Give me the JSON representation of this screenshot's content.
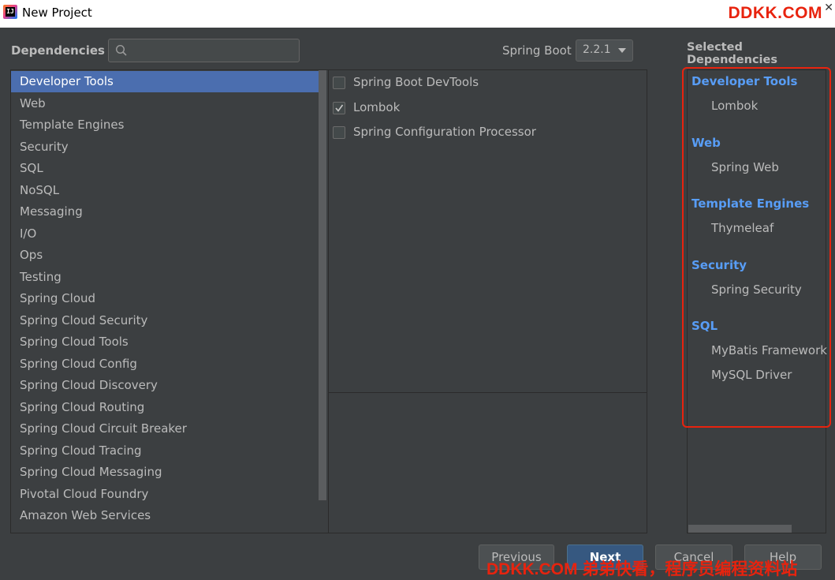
{
  "window": {
    "title": "New Project",
    "watermark_top": "DDKK.COM",
    "close_glyph": "✕"
  },
  "header": {
    "dependencies_label": "Dependencies",
    "search_placeholder": "",
    "search_value": "",
    "spring_boot_label": "Spring Boot",
    "spring_boot_version": "2.2.1"
  },
  "categories": [
    {
      "label": "Developer Tools",
      "selected": true
    },
    {
      "label": "Web"
    },
    {
      "label": "Template Engines"
    },
    {
      "label": "Security"
    },
    {
      "label": "SQL"
    },
    {
      "label": "NoSQL"
    },
    {
      "label": "Messaging"
    },
    {
      "label": "I/O"
    },
    {
      "label": "Ops"
    },
    {
      "label": "Testing"
    },
    {
      "label": "Spring Cloud"
    },
    {
      "label": "Spring Cloud Security"
    },
    {
      "label": "Spring Cloud Tools"
    },
    {
      "label": "Spring Cloud Config"
    },
    {
      "label": "Spring Cloud Discovery"
    },
    {
      "label": "Spring Cloud Routing"
    },
    {
      "label": "Spring Cloud Circuit Breaker"
    },
    {
      "label": "Spring Cloud Tracing"
    },
    {
      "label": "Spring Cloud Messaging"
    },
    {
      "label": "Pivotal Cloud Foundry"
    },
    {
      "label": "Amazon Web Services"
    }
  ],
  "dependencies": [
    {
      "label": "Spring Boot DevTools",
      "checked": false
    },
    {
      "label": "Lombok",
      "checked": true
    },
    {
      "label": "Spring Configuration Processor",
      "checked": false
    }
  ],
  "selected": {
    "title": "Selected Dependencies",
    "groups": [
      {
        "name": "Developer Tools",
        "items": [
          "Lombok"
        ]
      },
      {
        "name": "Web",
        "items": [
          "Spring Web"
        ]
      },
      {
        "name": "Template Engines",
        "items": [
          "Thymeleaf"
        ]
      },
      {
        "name": "Security",
        "items": [
          "Spring Security"
        ]
      },
      {
        "name": "SQL",
        "items": [
          "MyBatis Framework",
          "MySQL Driver"
        ]
      }
    ]
  },
  "buttons": {
    "previous": "Previous",
    "next": "Next",
    "cancel": "Cancel",
    "help": "Help"
  },
  "watermark_bottom": "DDKK.COM 弟弟快看，程序员编程资料站",
  "colors": {
    "background": "#3c3f41",
    "selection": "#4b6eaf",
    "group_heading": "#589df6",
    "highlight_box": "#e8230e"
  }
}
